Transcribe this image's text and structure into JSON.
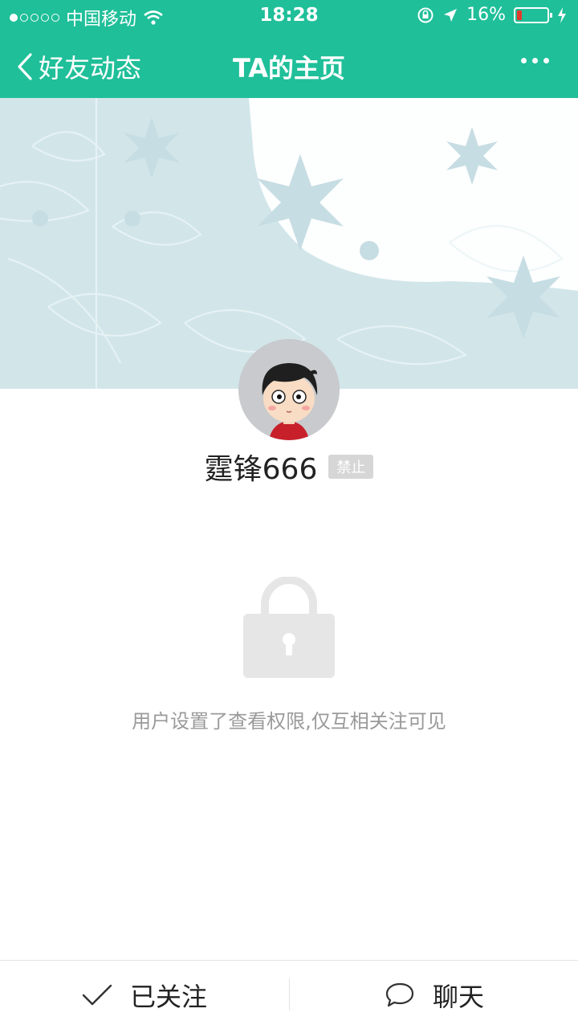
{
  "status_bar": {
    "carrier": "中国移动",
    "time": "18:28",
    "battery": "16%",
    "battery_level": 0.16
  },
  "nav": {
    "back_label": "好友动态",
    "title": "TA的主页"
  },
  "profile": {
    "username": "霆锋666",
    "badge": "禁止"
  },
  "privacy": {
    "notice": "用户设置了查看权限,仅互相关注可见"
  },
  "actions": {
    "follow_label": "已关注",
    "chat_label": "聊天"
  },
  "colors": {
    "accent": "#1fbf99",
    "cover": "#d2e6ea",
    "muted_text": "#9a9a9a"
  },
  "icons": [
    "signal-dots-icon",
    "wifi-icon",
    "rotation-lock-icon",
    "location-arrow-icon",
    "battery-icon",
    "charging-bolt-icon",
    "back-chevron-icon",
    "more-dots-icon",
    "lock-icon",
    "checkmark-icon",
    "chat-bubble-icon"
  ]
}
